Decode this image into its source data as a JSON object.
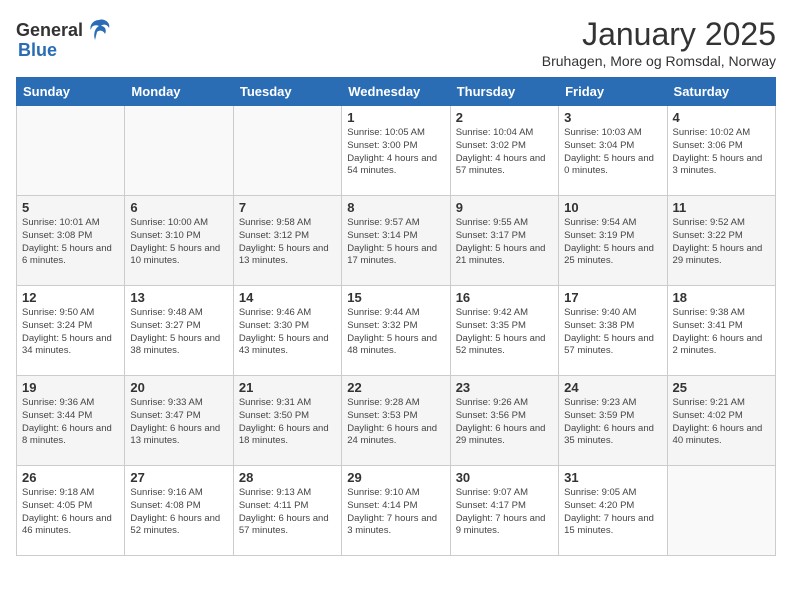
{
  "header": {
    "logo_general": "General",
    "logo_blue": "Blue",
    "title": "January 2025",
    "location": "Bruhagen, More og Romsdal, Norway"
  },
  "weekdays": [
    "Sunday",
    "Monday",
    "Tuesday",
    "Wednesday",
    "Thursday",
    "Friday",
    "Saturday"
  ],
  "weeks": [
    [
      {
        "day": "",
        "detail": ""
      },
      {
        "day": "",
        "detail": ""
      },
      {
        "day": "",
        "detail": ""
      },
      {
        "day": "1",
        "detail": "Sunrise: 10:05 AM\nSunset: 3:00 PM\nDaylight: 4 hours and 54 minutes."
      },
      {
        "day": "2",
        "detail": "Sunrise: 10:04 AM\nSunset: 3:02 PM\nDaylight: 4 hours and 57 minutes."
      },
      {
        "day": "3",
        "detail": "Sunrise: 10:03 AM\nSunset: 3:04 PM\nDaylight: 5 hours and 0 minutes."
      },
      {
        "day": "4",
        "detail": "Sunrise: 10:02 AM\nSunset: 3:06 PM\nDaylight: 5 hours and 3 minutes."
      }
    ],
    [
      {
        "day": "5",
        "detail": "Sunrise: 10:01 AM\nSunset: 3:08 PM\nDaylight: 5 hours and 6 minutes."
      },
      {
        "day": "6",
        "detail": "Sunrise: 10:00 AM\nSunset: 3:10 PM\nDaylight: 5 hours and 10 minutes."
      },
      {
        "day": "7",
        "detail": "Sunrise: 9:58 AM\nSunset: 3:12 PM\nDaylight: 5 hours and 13 minutes."
      },
      {
        "day": "8",
        "detail": "Sunrise: 9:57 AM\nSunset: 3:14 PM\nDaylight: 5 hours and 17 minutes."
      },
      {
        "day": "9",
        "detail": "Sunrise: 9:55 AM\nSunset: 3:17 PM\nDaylight: 5 hours and 21 minutes."
      },
      {
        "day": "10",
        "detail": "Sunrise: 9:54 AM\nSunset: 3:19 PM\nDaylight: 5 hours and 25 minutes."
      },
      {
        "day": "11",
        "detail": "Sunrise: 9:52 AM\nSunset: 3:22 PM\nDaylight: 5 hours and 29 minutes."
      }
    ],
    [
      {
        "day": "12",
        "detail": "Sunrise: 9:50 AM\nSunset: 3:24 PM\nDaylight: 5 hours and 34 minutes."
      },
      {
        "day": "13",
        "detail": "Sunrise: 9:48 AM\nSunset: 3:27 PM\nDaylight: 5 hours and 38 minutes."
      },
      {
        "day": "14",
        "detail": "Sunrise: 9:46 AM\nSunset: 3:30 PM\nDaylight: 5 hours and 43 minutes."
      },
      {
        "day": "15",
        "detail": "Sunrise: 9:44 AM\nSunset: 3:32 PM\nDaylight: 5 hours and 48 minutes."
      },
      {
        "day": "16",
        "detail": "Sunrise: 9:42 AM\nSunset: 3:35 PM\nDaylight: 5 hours and 52 minutes."
      },
      {
        "day": "17",
        "detail": "Sunrise: 9:40 AM\nSunset: 3:38 PM\nDaylight: 5 hours and 57 minutes."
      },
      {
        "day": "18",
        "detail": "Sunrise: 9:38 AM\nSunset: 3:41 PM\nDaylight: 6 hours and 2 minutes."
      }
    ],
    [
      {
        "day": "19",
        "detail": "Sunrise: 9:36 AM\nSunset: 3:44 PM\nDaylight: 6 hours and 8 minutes."
      },
      {
        "day": "20",
        "detail": "Sunrise: 9:33 AM\nSunset: 3:47 PM\nDaylight: 6 hours and 13 minutes."
      },
      {
        "day": "21",
        "detail": "Sunrise: 9:31 AM\nSunset: 3:50 PM\nDaylight: 6 hours and 18 minutes."
      },
      {
        "day": "22",
        "detail": "Sunrise: 9:28 AM\nSunset: 3:53 PM\nDaylight: 6 hours and 24 minutes."
      },
      {
        "day": "23",
        "detail": "Sunrise: 9:26 AM\nSunset: 3:56 PM\nDaylight: 6 hours and 29 minutes."
      },
      {
        "day": "24",
        "detail": "Sunrise: 9:23 AM\nSunset: 3:59 PM\nDaylight: 6 hours and 35 minutes."
      },
      {
        "day": "25",
        "detail": "Sunrise: 9:21 AM\nSunset: 4:02 PM\nDaylight: 6 hours and 40 minutes."
      }
    ],
    [
      {
        "day": "26",
        "detail": "Sunrise: 9:18 AM\nSunset: 4:05 PM\nDaylight: 6 hours and 46 minutes."
      },
      {
        "day": "27",
        "detail": "Sunrise: 9:16 AM\nSunset: 4:08 PM\nDaylight: 6 hours and 52 minutes."
      },
      {
        "day": "28",
        "detail": "Sunrise: 9:13 AM\nSunset: 4:11 PM\nDaylight: 6 hours and 57 minutes."
      },
      {
        "day": "29",
        "detail": "Sunrise: 9:10 AM\nSunset: 4:14 PM\nDaylight: 7 hours and 3 minutes."
      },
      {
        "day": "30",
        "detail": "Sunrise: 9:07 AM\nSunset: 4:17 PM\nDaylight: 7 hours and 9 minutes."
      },
      {
        "day": "31",
        "detail": "Sunrise: 9:05 AM\nSunset: 4:20 PM\nDaylight: 7 hours and 15 minutes."
      },
      {
        "day": "",
        "detail": ""
      }
    ]
  ]
}
